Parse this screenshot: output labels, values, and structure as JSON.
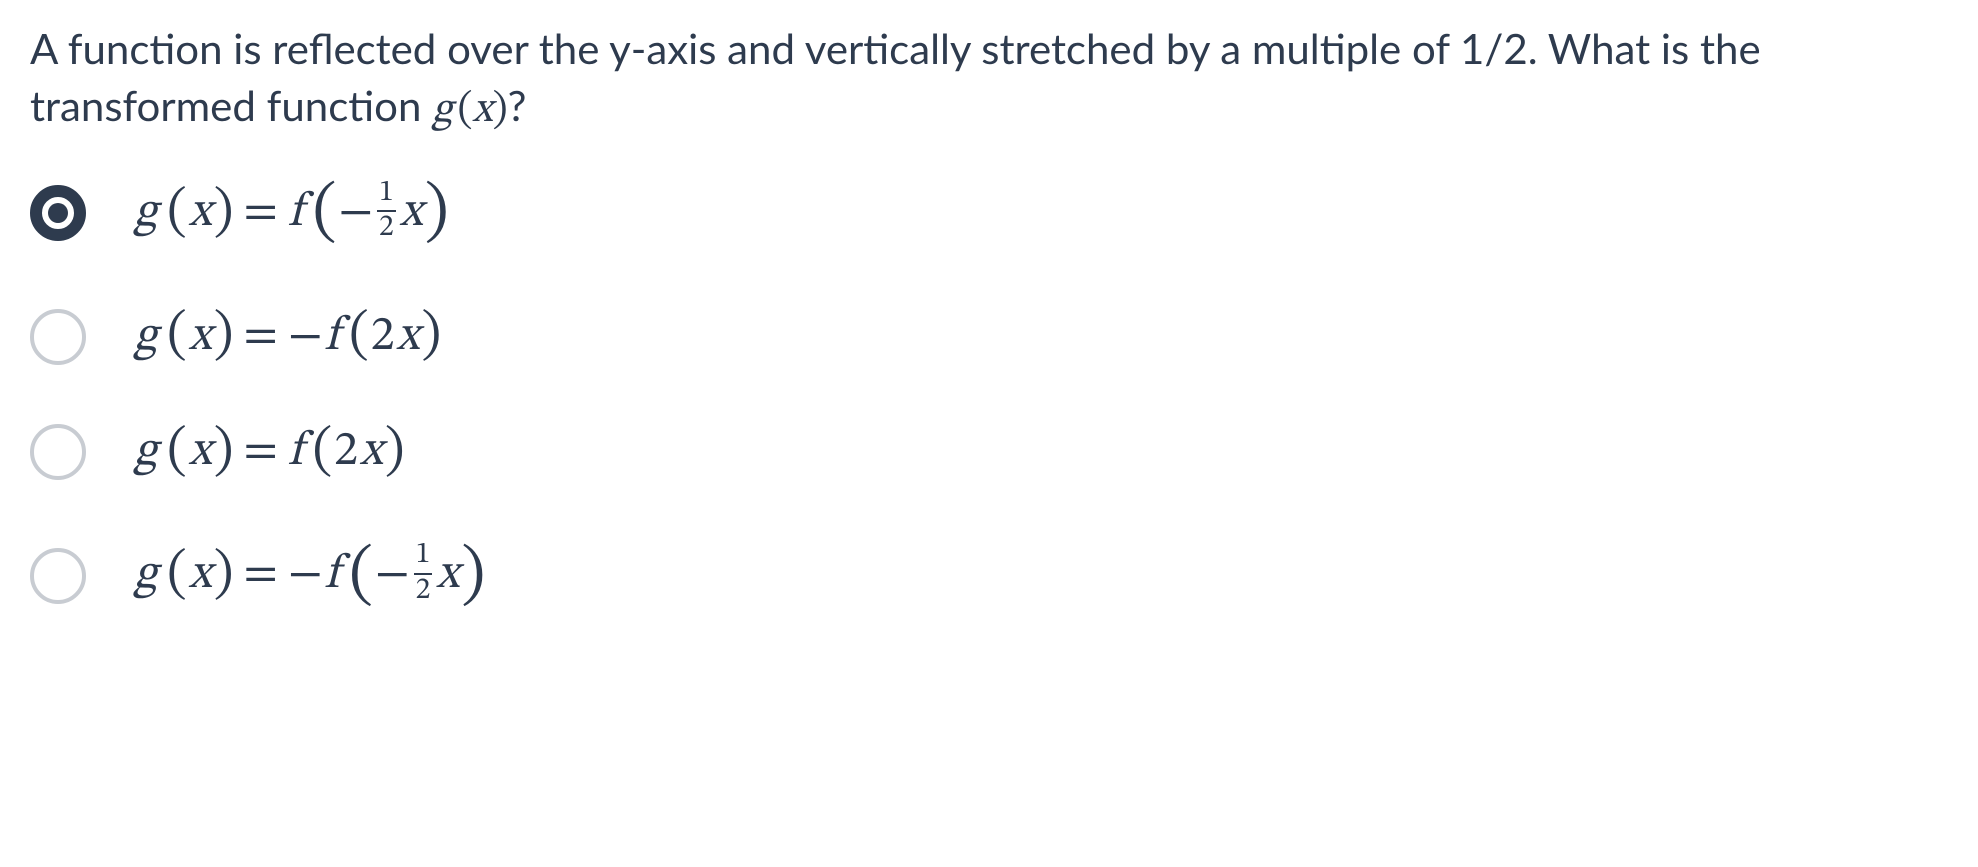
{
  "question": {
    "text_part1": "A function is reflected over the y-axis and vertically stretched by a multiple of 1/2. What is the transformed function ",
    "g": "g",
    "open": "(",
    "x": "x",
    "close": ")",
    "qmark": "?"
  },
  "options": {
    "a": {
      "selected": true,
      "lhs_g": "g",
      "lhs_open": "(",
      "lhs_x": "x",
      "lhs_close": ")",
      "eq": " = ",
      "rhs_f": "f",
      "rhs_open": "(",
      "rhs_neg": "−",
      "frac_num": "1",
      "frac_den": "2",
      "rhs_x": "x",
      "rhs_close": ")"
    },
    "b": {
      "selected": false,
      "lhs_g": "g",
      "lhs_open": "(",
      "lhs_x": "x",
      "lhs_close": ")",
      "eq": " = ",
      "rhs_neg": "−",
      "rhs_f": "f",
      "rhs_open": "(",
      "rhs_2": "2",
      "rhs_x": "x",
      "rhs_close": ")"
    },
    "c": {
      "selected": false,
      "lhs_g": "g",
      "lhs_open": "(",
      "lhs_x": "x",
      "lhs_close": ")",
      "eq": " = ",
      "rhs_f": "f",
      "rhs_open": "(",
      "rhs_2": "2",
      "rhs_x": "x",
      "rhs_close": ")"
    },
    "d": {
      "selected": false,
      "lhs_g": "g",
      "lhs_open": "(",
      "lhs_x": "x",
      "lhs_close": ")",
      "eq": " = ",
      "rhs_neg_out": "−",
      "rhs_f": "f",
      "rhs_open": "(",
      "rhs_neg_in": "−",
      "frac_num": "1",
      "frac_den": "2",
      "rhs_x": "x",
      "rhs_close": ")"
    }
  }
}
